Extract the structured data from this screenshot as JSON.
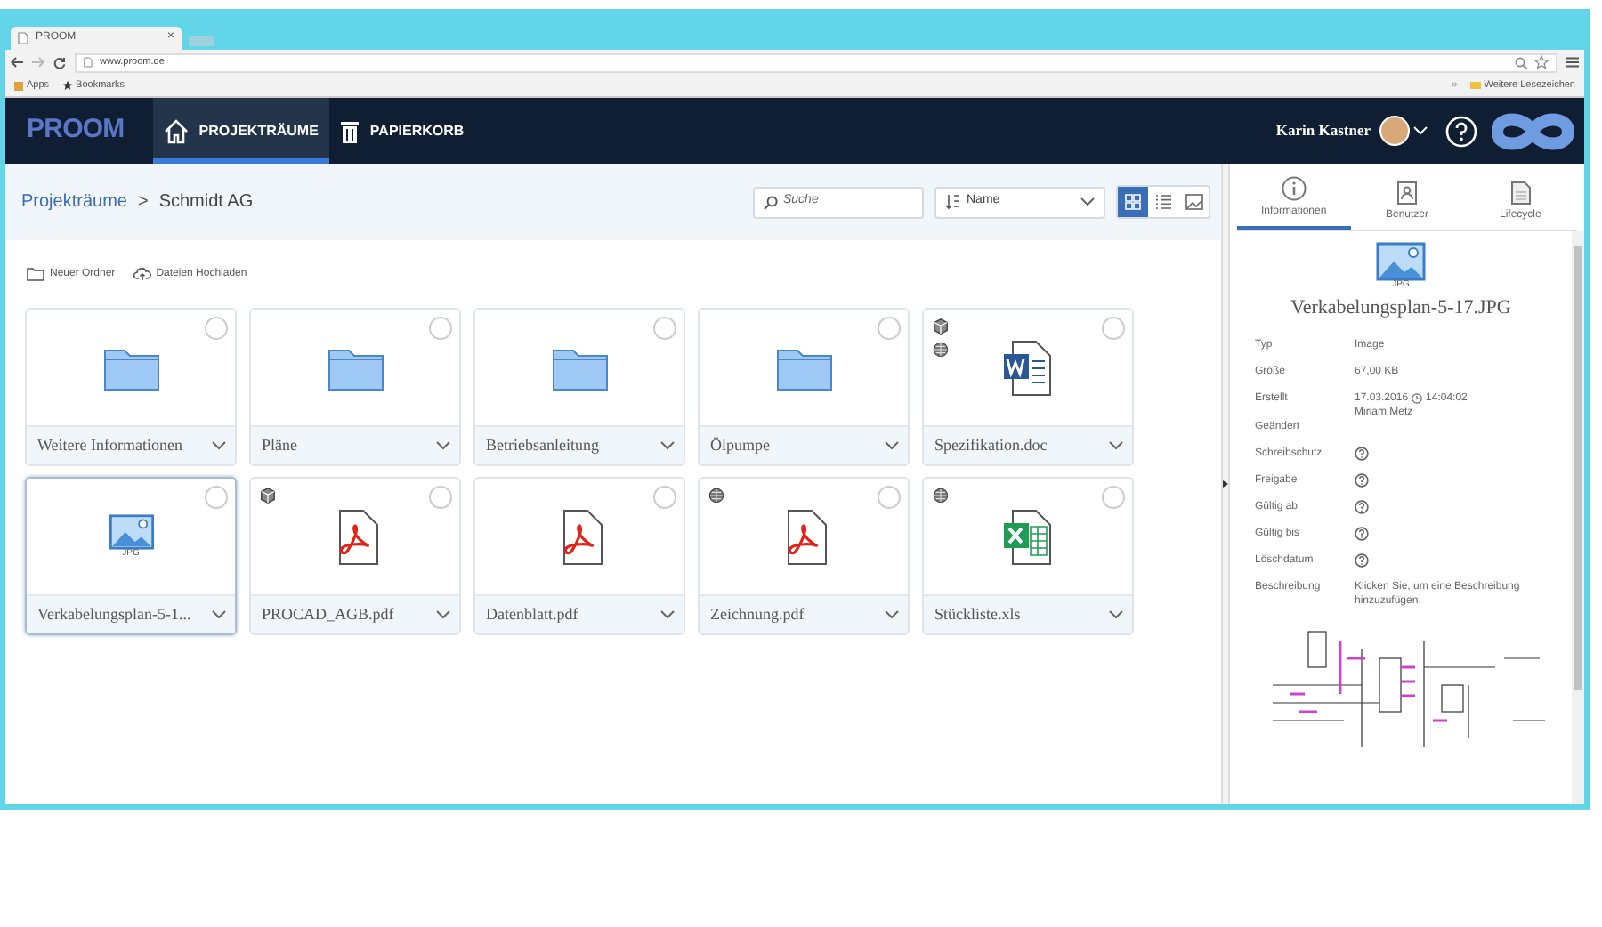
{
  "browser": {
    "tab": {
      "title": "PROOM",
      "close": "×"
    },
    "address": "www.proom.de",
    "bookmarks": [
      {
        "label": "Apps",
        "kind": "apps"
      },
      {
        "label": "Bookmarks",
        "kind": "star"
      }
    ],
    "more": "»",
    "other_bookmarks": "Weitere Lesezeichen"
  },
  "header": {
    "logo": "PROOM",
    "nav": [
      {
        "label": "PROJEKTRÄUME",
        "kind": "home",
        "selected": true
      },
      {
        "label": "PAPIERKORB",
        "kind": "trash",
        "selected": false
      }
    ],
    "user": "Karin Kastner"
  },
  "breadcrumb": {
    "items": [
      "Projekträume"
    ],
    "separator": ">",
    "current": "Schmidt AG"
  },
  "search": {
    "placeholder": "Suche"
  },
  "sort": {
    "value": "Name"
  },
  "views": [
    {
      "kind": "grid",
      "selected": true
    },
    {
      "kind": "list",
      "selected": false
    },
    {
      "kind": "preview",
      "selected": false
    }
  ],
  "actions": [
    {
      "label": "Neuer Ordner",
      "kind": "folder"
    },
    {
      "label": "Dateien Hochladen",
      "kind": "upload"
    }
  ],
  "items": [
    {
      "name": "Weitere Informationen",
      "kind": "folder",
      "selected": false,
      "cube_badge": false,
      "globe_badge": false
    },
    {
      "name": "Pläne",
      "kind": "folder",
      "selected": false,
      "cube_badge": false,
      "globe_badge": false
    },
    {
      "name": "Betriebsanleitung",
      "kind": "folder",
      "selected": false,
      "cube_badge": false,
      "globe_badge": false
    },
    {
      "name": "Ölpumpe",
      "kind": "folder",
      "selected": false,
      "cube_badge": false,
      "globe_badge": false
    },
    {
      "name": "Spezifikation.doc",
      "kind": "word",
      "selected": false,
      "cube_badge": true,
      "globe_badge": true
    },
    {
      "name": "Verkabelungsplan-5-1...",
      "kind": "image",
      "type_label": "JPG",
      "selected": true,
      "cube_badge": false,
      "globe_badge": false
    },
    {
      "name": "PROCAD_AGB.pdf",
      "kind": "pdf",
      "selected": false,
      "cube_badge": true,
      "globe_badge": false
    },
    {
      "name": "Datenblatt.pdf",
      "kind": "pdf",
      "selected": false,
      "cube_badge": false,
      "globe_badge": false
    },
    {
      "name": "Zeichnung.pdf",
      "kind": "pdf",
      "selected": false,
      "cube_badge": false,
      "globe_badge": true
    },
    {
      "name": "Stückliste.xls",
      "kind": "excel",
      "selected": false,
      "cube_badge": false,
      "globe_badge": true
    }
  ],
  "panel": {
    "tabs": [
      {
        "label": "Informationen",
        "kind": "info",
        "selected": true
      },
      {
        "label": "Benutzer",
        "kind": "user",
        "selected": false
      },
      {
        "label": "Lifecycle",
        "kind": "doc",
        "selected": false
      }
    ],
    "file_type": "JPG",
    "file_name": "Verkabelungsplan-5-17.JPG",
    "fields": [
      {
        "label": "Typ",
        "kind": "text",
        "value": "Image"
      },
      {
        "label": "Größe",
        "kind": "text",
        "value": "67,00 KB"
      },
      {
        "label": "Erstellt",
        "kind": "created",
        "date": "17.03.2016",
        "time": "14:04:02",
        "author": "Miriam Metz"
      },
      {
        "label": "Geändert",
        "kind": "empty"
      },
      {
        "label": "Schreibschutz",
        "kind": "help"
      },
      {
        "label": "Freigabe",
        "kind": "help"
      },
      {
        "label": "Gültig ab",
        "kind": "help"
      },
      {
        "label": "Gültig bis",
        "kind": "help"
      },
      {
        "label": "Löschdatum",
        "kind": "help"
      },
      {
        "label": "Beschreibung",
        "kind": "text",
        "value": "Klicken Sie, um eine Beschreibung hinzuzufügen."
      }
    ]
  }
}
